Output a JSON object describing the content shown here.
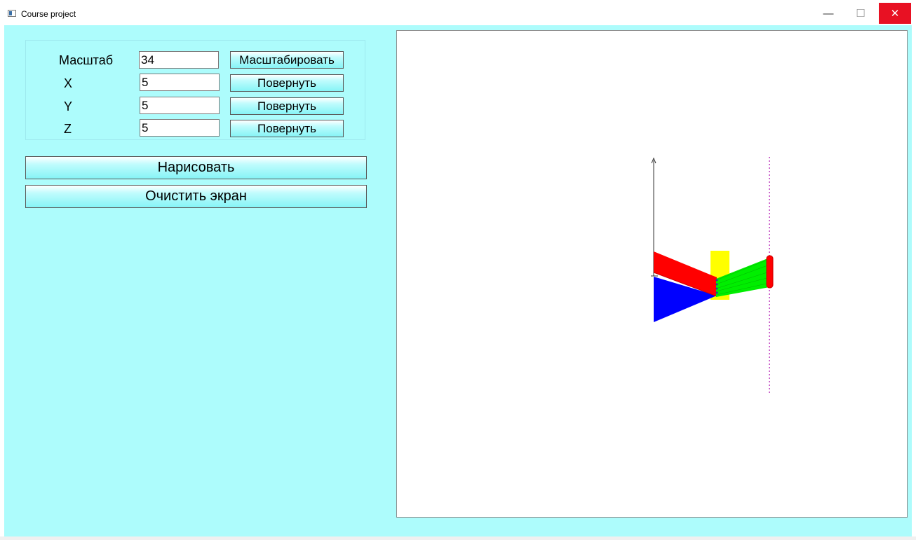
{
  "window": {
    "title": "Course project",
    "icons": {
      "app": "app-window-icon",
      "minimize": "minimize-icon",
      "maximize": "maximize-icon",
      "close": "close-icon"
    },
    "minimize_glyph": "—",
    "maximize_glyph": "☐",
    "close_glyph": "✕"
  },
  "controls": {
    "scale_label": "Масштаб",
    "scale_value": "34",
    "scale_button": "Масштабировать",
    "x_label": "X",
    "x_value": "5",
    "x_button": "Повернуть",
    "y_label": "Y",
    "y_value": "5",
    "y_button": "Повернуть",
    "z_label": "Z",
    "z_value": "5",
    "z_button": "Повернуть"
  },
  "actions": {
    "draw_button": "Нарисовать",
    "clear_button": "Очистить экран"
  },
  "colors": {
    "background": "#adfcfc",
    "close_button": "#e81123",
    "red_beam": "#ff0000",
    "blue_cone": "#0000ff",
    "green_rays": "#00ff00",
    "yellow_lens": "#ffff00",
    "screen_line": "#cc66cc"
  }
}
